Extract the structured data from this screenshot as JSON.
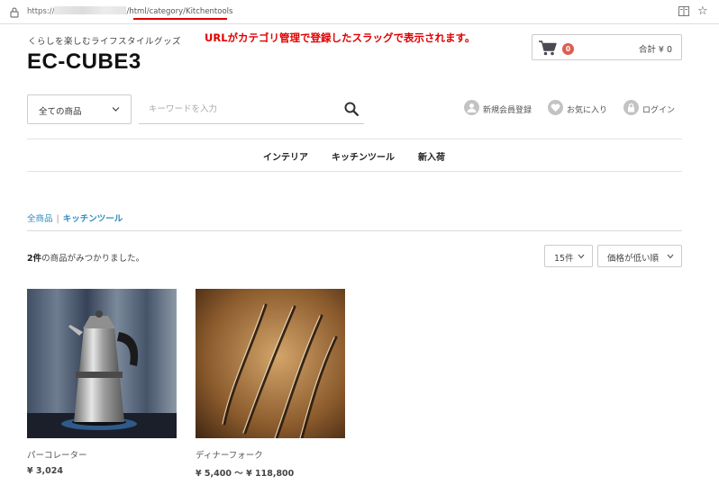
{
  "browser": {
    "url_prefix": "https://",
    "url_path": "/html/category/Kitchentools",
    "url_path_base": "/html/",
    "url_path_highlight": "category/Kitchentools"
  },
  "annotation": "URLがカテゴリ管理で登録したスラッグで表示されます。",
  "header": {
    "tagline": "くらしを楽しむライフスタイルグッズ",
    "logo": "EC-CUBE3",
    "cart": {
      "badge": "0",
      "total_label": "合計 ¥ 0"
    }
  },
  "search": {
    "category_value": "全ての商品",
    "placeholder": "キーワードを入力"
  },
  "utility": {
    "register": "新規会員登録",
    "favorites": "お気に入り",
    "login": "ログイン"
  },
  "nav": [
    "インテリア",
    "キッチンツール",
    "新入荷"
  ],
  "breadcrumb": {
    "root": "全商品",
    "current": "キッチンツール"
  },
  "results": {
    "count": "2件",
    "count_suffix": "の商品がみつかりました。"
  },
  "sort": {
    "per_page": "15件",
    "order": "価格が低い順"
  },
  "products": [
    {
      "name": "パーコレーター",
      "price": "¥ 3,024",
      "image": "percolator-photo"
    },
    {
      "name": "ディナーフォーク",
      "price": "¥ 5,400 ～ ¥ 118,800",
      "image": "dinner-forks-photo"
    }
  ],
  "colors": {
    "accent": "#2f8bc0",
    "badge": "#de5d50",
    "annotation": "#e00000"
  }
}
